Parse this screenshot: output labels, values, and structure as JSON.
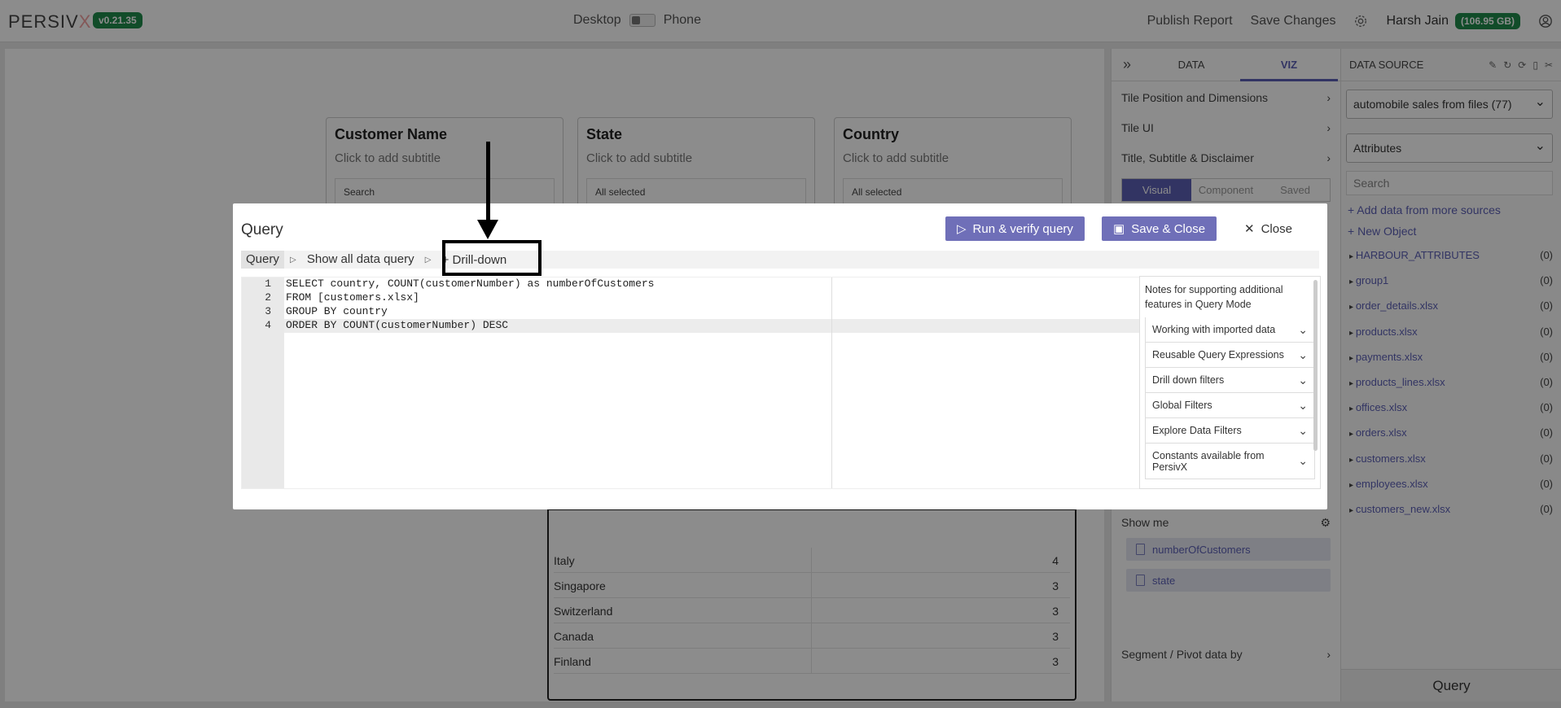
{
  "app": {
    "logo": "PERSIV",
    "logo_x": "X",
    "version": "v0.21.35",
    "mode_desktop": "Desktop",
    "mode_phone": "Phone",
    "publish": "Publish Report",
    "save_changes": "Save Changes",
    "user": "Harsh Jain",
    "storage": "(106.95 GB)"
  },
  "canvas": {
    "cards": [
      {
        "title": "Customer Name",
        "subtitle": "Click to add subtitle",
        "input": "Search"
      },
      {
        "title": "State",
        "subtitle": "Click to add subtitle",
        "input": "All selected"
      },
      {
        "title": "Country",
        "subtitle": "Click to add subtitle",
        "input": "All selected"
      }
    ],
    "table_rows": [
      {
        "country": "Italy",
        "count": "4"
      },
      {
        "country": "Singapore",
        "count": "3"
      },
      {
        "country": "Switzerland",
        "count": "3"
      },
      {
        "country": "Canada",
        "count": "3"
      },
      {
        "country": "Finland",
        "count": "3"
      }
    ]
  },
  "right_panel": {
    "tab_data": "DATA",
    "tab_viz": "VIZ",
    "rows": [
      "Tile Position and Dimensions",
      "Tile UI",
      "Title, Subtitle & Disclaimer"
    ],
    "subtabs": [
      "Visual",
      "Component",
      "Saved"
    ],
    "show_me": "Show me",
    "chips": [
      "numberOfCustomers",
      "state"
    ],
    "segment": "Segment / Pivot data by"
  },
  "data_source": {
    "title": "DATA SOURCE",
    "selected_source": "automobile sales from files (77)",
    "attributes": "Attributes",
    "search_placeholder": "Search",
    "add_data": "Add data from more sources",
    "new_object": "New Object",
    "items": [
      {
        "name": "HARBOUR_ATTRIBUTES",
        "count": "(0)"
      },
      {
        "name": "group1",
        "count": "(0)"
      },
      {
        "name": "order_details.xlsx",
        "count": "(0)"
      },
      {
        "name": "products.xlsx",
        "count": "(0)"
      },
      {
        "name": "payments.xlsx",
        "count": "(0)"
      },
      {
        "name": "products_lines.xlsx",
        "count": "(0)"
      },
      {
        "name": "offices.xlsx",
        "count": "(0)"
      },
      {
        "name": "orders.xlsx",
        "count": "(0)"
      },
      {
        "name": "customers.xlsx",
        "count": "(0)"
      },
      {
        "name": "employees.xlsx",
        "count": "(0)"
      },
      {
        "name": "customers_new.xlsx",
        "count": "(0)"
      }
    ],
    "query_button": "Query"
  },
  "modal": {
    "title": "Query",
    "run_button": "Run & verify query",
    "save_button": "Save & Close",
    "close_button": "Close",
    "tab_query": "Query",
    "tab_show_all": "Show all data query",
    "drill_down": "+ Drill-down",
    "code_lines": [
      "SELECT country, COUNT(customerNumber) as numberOfCustomers",
      "FROM [customers.xlsx]",
      "GROUP BY country",
      "ORDER BY COUNT(customerNumber) DESC"
    ],
    "line_numbers": [
      "1",
      "2",
      "3",
      "4"
    ],
    "notes_title": "Notes for supporting additional features in Query Mode",
    "notes_items": [
      "Working with imported data",
      "Reusable Query Expressions",
      "Drill down filters",
      "Global Filters",
      "Explore Data Filters",
      "Constants available from PersivX"
    ]
  }
}
